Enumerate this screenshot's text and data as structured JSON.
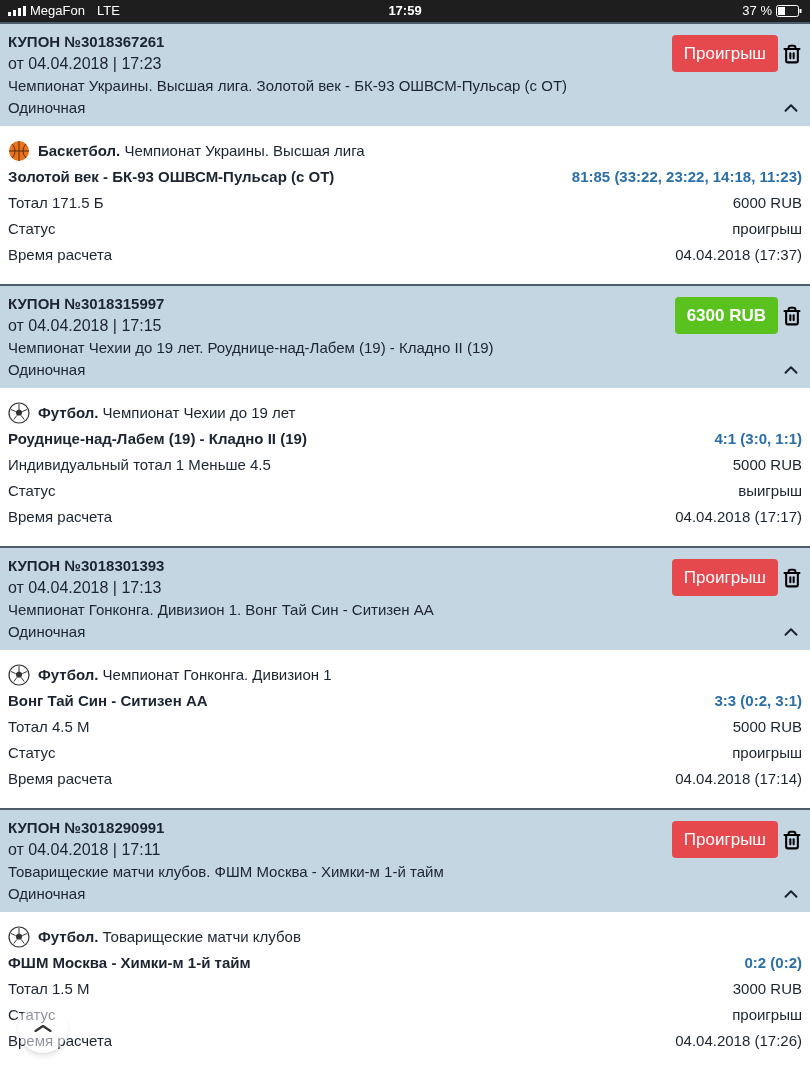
{
  "status_bar": {
    "carrier": "MegaFon",
    "network": "LTE",
    "time": "17:59",
    "battery": "37 %"
  },
  "coupons": [
    {
      "number": "КУПОН №3018367261",
      "date": "от 04.04.2018 | 17:23",
      "event": "Чемпионат Украины. Высшая лига. Золотой век - БК-93 ОШВСМ-Пульсар (с ОТ)",
      "type": "Одиночная",
      "expanded": true,
      "result": {
        "kind": "lost",
        "text": "Проигрыш"
      },
      "sport": {
        "kind": "basketball",
        "name": "Баскетбол.",
        "league": "Чемпионат Украины. Высшая лига"
      },
      "match": "Золотой век - БК-93 ОШВСМ-Пульсар (с ОТ)",
      "score": "81:85 (33:22, 23:22, 14:18, 11:23)",
      "bet": "Тотал 171.5 Б",
      "stake": "6000 RUB",
      "status_label": "Статус",
      "status": "проигрыш",
      "time_label": "Время расчета",
      "time": "04.04.2018 (17:37)"
    },
    {
      "number": "КУПОН №3018315997",
      "date": "от 04.04.2018 | 17:15",
      "event": "Чемпионат Чехии до 19 лет. Роуднице-над-Лабем (19) - Кладно II (19)",
      "type": "Одиночная",
      "expanded": true,
      "result": {
        "kind": "won",
        "text": "6300 RUB"
      },
      "sport": {
        "kind": "football",
        "name": "Футбол.",
        "league": "Чемпионат Чехии до 19 лет"
      },
      "match": "Роуднице-над-Лабем (19) - Кладно II (19)",
      "score": "4:1 (3:0, 1:1)",
      "bet": "Индивидуальный тотал 1 Меньше 4.5",
      "stake": "5000 RUB",
      "status_label": "Статус",
      "status": "выигрыш",
      "time_label": "Время расчета",
      "time": "04.04.2018 (17:17)"
    },
    {
      "number": "КУПОН №3018301393",
      "date": "от 04.04.2018 | 17:13",
      "event": "Чемпионат Гонконга. Дивизион 1. Вонг Тай Син - Ситизен АА",
      "type": "Одиночная",
      "expanded": true,
      "result": {
        "kind": "lost",
        "text": "Проигрыш"
      },
      "sport": {
        "kind": "football",
        "name": "Футбол.",
        "league": "Чемпионат Гонконга. Дивизион 1"
      },
      "match": "Вонг Тай Син - Ситизен АА",
      "score": "3:3 (0:2, 3:1)",
      "bet": "Тотал 4.5 М",
      "stake": "5000 RUB",
      "status_label": "Статус",
      "status": "проигрыш",
      "time_label": "Время расчета",
      "time": "04.04.2018 (17:14)"
    },
    {
      "number": "КУПОН №3018290991",
      "date": "от 04.04.2018 | 17:11",
      "event": "Товарищеские матчи клубов. ФШМ Москва - Химки-м 1-й тайм",
      "type": "Одиночная",
      "expanded": true,
      "result": {
        "kind": "lost",
        "text": "Проигрыш"
      },
      "sport": {
        "kind": "football",
        "name": "Футбол.",
        "league": "Товарищеские матчи клубов"
      },
      "match": "ФШМ Москва - Химки-м 1-й тайм",
      "score": "0:2 (0:2)",
      "bet": "Тотал 1.5 М",
      "stake": "3000 RUB",
      "status_label": "Статус",
      "status": "проигрыш",
      "time_label": "Время расчета",
      "time": "04.04.2018 (17:26)"
    }
  ]
}
